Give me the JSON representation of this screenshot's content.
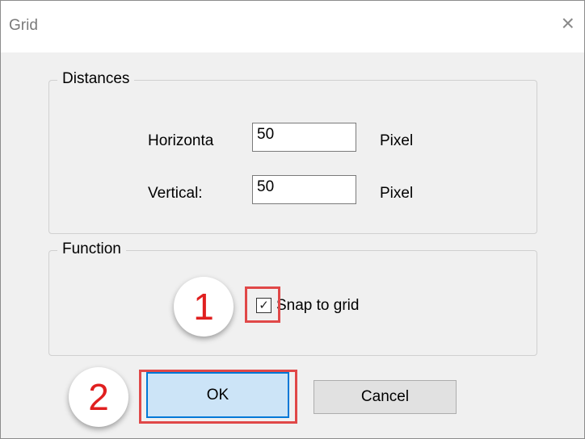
{
  "window": {
    "title": "Grid",
    "close_icon": "×"
  },
  "distances": {
    "legend": "Distances",
    "horizontal": {
      "label": "Horizonta",
      "value": "50",
      "unit": "Pixel"
    },
    "vertical": {
      "label": "Vertical:",
      "value": "50",
      "unit": "Pixel"
    }
  },
  "function": {
    "legend": "Function",
    "snap_to_grid": {
      "label": "Snap to grid",
      "checked": true,
      "check_glyph": "✓"
    }
  },
  "buttons": {
    "ok": "OK",
    "cancel": "Cancel"
  },
  "annotations": {
    "step1": "1",
    "step2": "2",
    "highlight_color": "#e04848"
  }
}
